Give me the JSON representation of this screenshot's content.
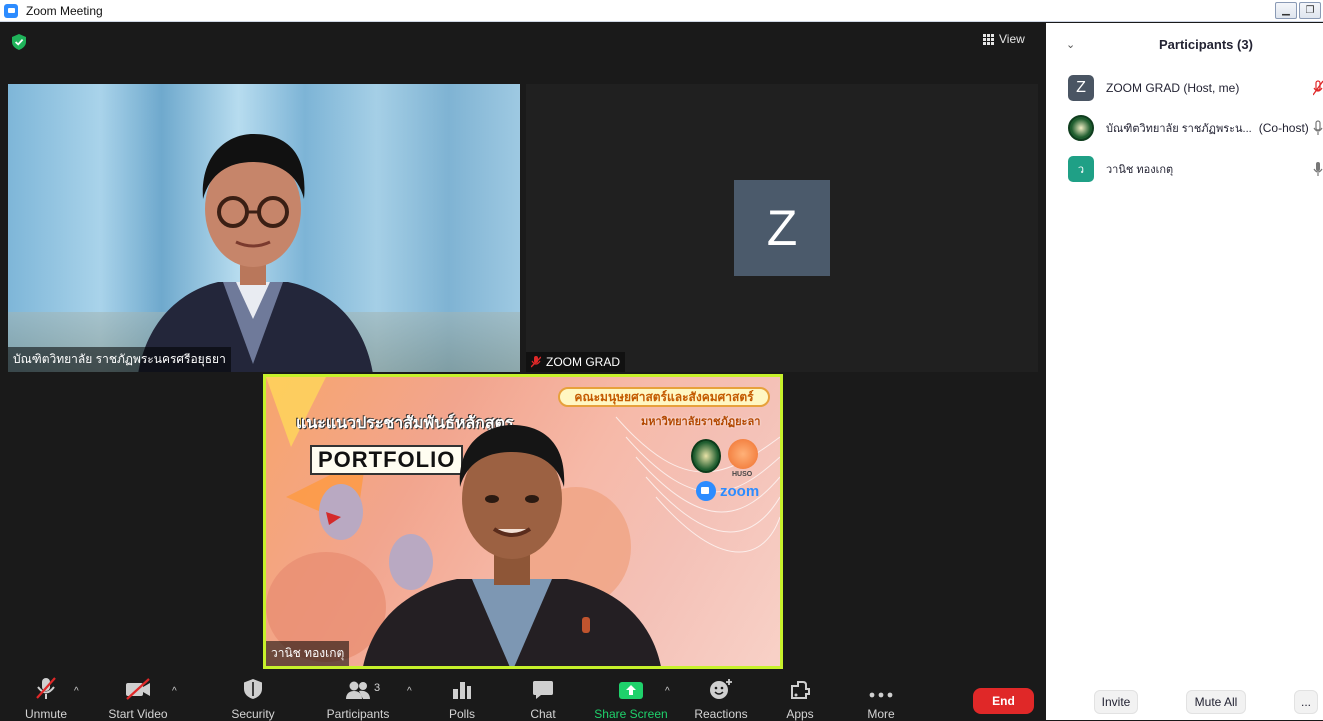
{
  "window": {
    "title": "Zoom Meeting"
  },
  "top_bar": {
    "view_label": "View"
  },
  "videos": [
    {
      "name": "บัณฑิตวิทยาลัย ราชภัฏพระนครศรีอยุธยา",
      "muted": false
    },
    {
      "name": "ZOOM GRAD",
      "initial": "Z",
      "muted": true
    },
    {
      "name": "วานิช ทองเกตุ",
      "muted": false,
      "active_speaker": true
    }
  ],
  "shared_background": {
    "banner_top": "คณะมนุษยศาสตร์และสังคมศาสตร์",
    "banner_sub": "มหาวิทยาลัยราชภัฏยะลา",
    "heading": "แนะแนวประชาสัมพันธ์หลักสูตร",
    "portfolio": "PORTFOLIO",
    "huso": "HUSO",
    "zoom_text": "zoom"
  },
  "toolbar": {
    "unmute": "Unmute",
    "start_video": "Start Video",
    "security": "Security",
    "participants": "Participants",
    "participants_count": "3",
    "polls": "Polls",
    "chat": "Chat",
    "share_screen": "Share Screen",
    "reactions": "Reactions",
    "apps": "Apps",
    "more": "More",
    "end": "End"
  },
  "participants_panel": {
    "title": "Participants (3)",
    "items": [
      {
        "initial": "Z",
        "name": "ZOOM GRAD (Host, me)",
        "mic": "muted"
      },
      {
        "initial": "",
        "name": "บัณฑิตวิทยาลัย ราชภัฏพระน...",
        "role": "(Co-host)",
        "mic": "on"
      },
      {
        "initial": "ว",
        "name": "วานิช ทองเกตุ",
        "mic": "on"
      }
    ],
    "invite": "Invite",
    "mute_all": "Mute All",
    "more": "..."
  },
  "colors": {
    "accent_green": "#1fd16b",
    "end_red": "#e02828",
    "active_speaker_border": "#c7f12b",
    "zoom_blue": "#2d8cff"
  }
}
